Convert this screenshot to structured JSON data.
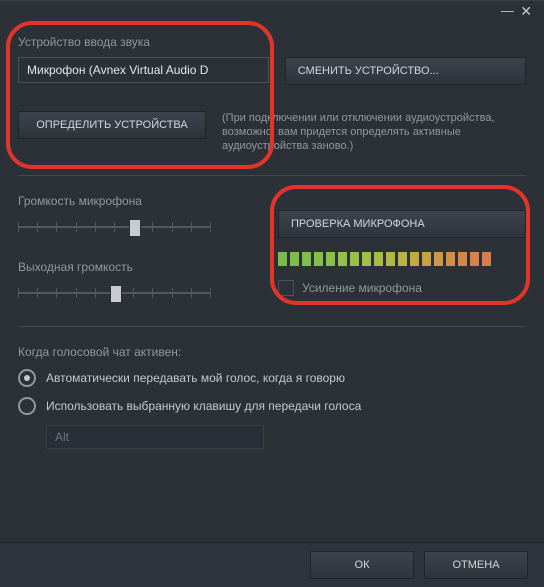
{
  "section_input_device": {
    "label": "Устройство ввода звука",
    "value": "Микрофон (Avnex Virtual Audio D",
    "change_button": "СМЕНИТЬ УСТРОЙСТВО...",
    "detect_button": "ОПРЕДЕЛИТЬ УСТРОЙСТВА",
    "hint": "(При подключении или отключении аудиоустройства, возможно, вам придется определять активные аудиоустройства заново.)"
  },
  "mic_volume": {
    "label": "Громкость микрофона",
    "value": 0.58,
    "ticks": 11
  },
  "output_volume": {
    "label": "Выходная громкость",
    "value": 0.48,
    "ticks": 11
  },
  "mic_test": {
    "button": "ПРОВЕРКА МИКРОФОНА",
    "boost_label": "Усиление микрофона",
    "boost_checked": false,
    "levels": [
      "#7cbb4b",
      "#7dbd4b",
      "#80be4a",
      "#85bf49",
      "#8bc048",
      "#91c147",
      "#98c145",
      "#a0bf44",
      "#a8bc43",
      "#b1b842",
      "#bab242",
      "#c2aa42",
      "#c8a143",
      "#cd9844",
      "#d18f46",
      "#d48749",
      "#d6814b",
      "#d87b4d"
    ]
  },
  "voice_chat": {
    "label": "Когда голосовой чат активен:",
    "option_auto": "Автоматически передавать мой голос, когда я говорю",
    "option_key": "Использовать выбранную клавишу для передачи голоса",
    "selected": "auto",
    "key_placeholder": "Alt"
  },
  "footer": {
    "ok": "ОК",
    "cancel": "ОТМЕНА"
  }
}
